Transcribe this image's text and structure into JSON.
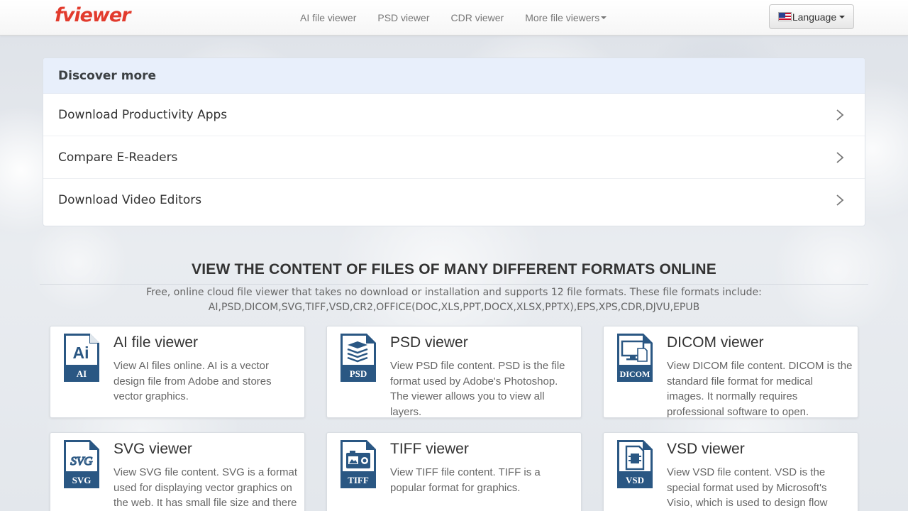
{
  "header": {
    "logo": "fviewer",
    "nav": [
      {
        "label": "AI file viewer"
      },
      {
        "label": "PSD viewer"
      },
      {
        "label": "CDR viewer"
      },
      {
        "label": "More file viewers"
      }
    ],
    "language_label": "Language"
  },
  "discover": {
    "title": "Discover more",
    "items": [
      {
        "label": "Download Productivity Apps"
      },
      {
        "label": "Compare E-Readers"
      },
      {
        "label": "Download Video Editors"
      }
    ]
  },
  "main": {
    "headline": "VIEW THE CONTENT OF FILES OF MANY DIFFERENT FORMATS ONLINE",
    "intro_line1": "Free, online cloud file viewer that takes no download or installation and supports 12 file formats. These file formats include:",
    "intro_line2": "AI,PSD,DICOM,SVG,TIFF,VSD,CR2,OFFICE(DOC,XLS,PPT,DOCX,XLSX,PPTX),EPS,XPS,CDR,DJVU,EPUB"
  },
  "viewers": [
    {
      "title": "AI file viewer",
      "badge": "AI",
      "glyph": "Ai",
      "desc": "View AI files online. AI is a vector design file from Adobe and stores vector graphics."
    },
    {
      "title": "PSD viewer",
      "badge": "PSD",
      "glyph": "layers",
      "desc": "View PSD file content. PSD is the file format used by Adobe's Photoshop. The viewer allows you to view all layers."
    },
    {
      "title": "DICOM viewer",
      "badge": "DICOM",
      "glyph": "monitor",
      "desc": "View DICOM file content. DICOM is the standard file format for medical images. It normally requires professional software to open."
    },
    {
      "title": "SVG viewer",
      "badge": "SVG",
      "glyph": "SVG",
      "desc": "View SVG file content. SVG is a format used for displaying vector graphics on the web. It has small file size and there"
    },
    {
      "title": "TIFF viewer",
      "badge": "TIFF",
      "glyph": "image",
      "desc": "View TIFF file content. TIFF is a popular format for graphics."
    },
    {
      "title": "VSD viewer",
      "badge": "VSD",
      "glyph": "doc",
      "desc": "View VSD file content. VSD is the special format used by Microsoft's Visio, which is used to design flow"
    }
  ],
  "colors": {
    "icon_blue": "#2a5783",
    "logo_red": "#e23b2d",
    "discover_header_bg": "#e8effb"
  },
  "icons": [
    "chevron-right-icon",
    "caret-down-icon",
    "us-flag-icon",
    "ai-file-icon",
    "psd-file-icon",
    "dicom-file-icon",
    "svg-file-icon",
    "tiff-file-icon",
    "vsd-file-icon"
  ]
}
